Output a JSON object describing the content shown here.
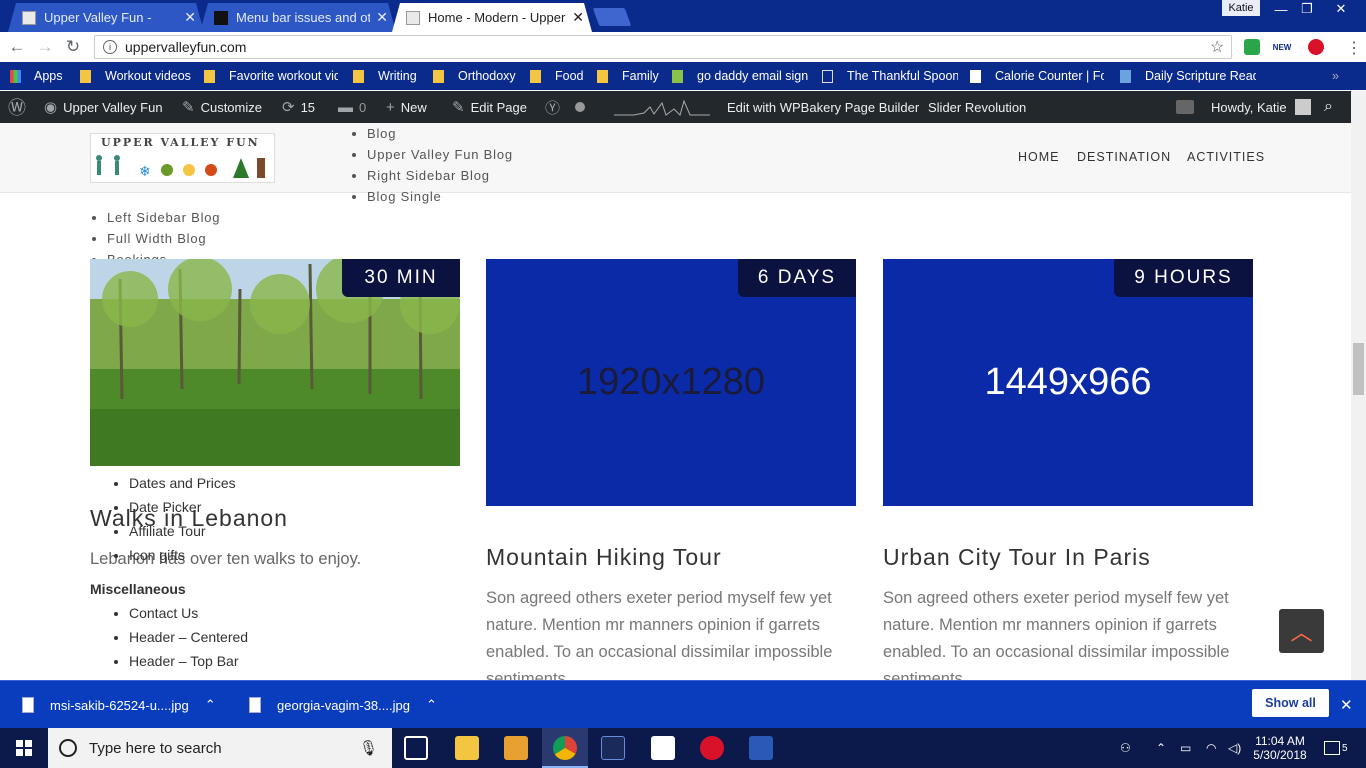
{
  "browser": {
    "tabs": [
      {
        "title": "Upper Valley Fun -",
        "active": false
      },
      {
        "title": "Menu bar issues and othe",
        "active": false
      },
      {
        "title": "Home - Modern - Upper",
        "active": true
      }
    ],
    "profile": "Katie",
    "url": "uppervalleyfun.com",
    "bookmarks": [
      "Apps",
      "Workout videos",
      "Favorite workout vid",
      "Writing",
      "Orthodoxy",
      "Food",
      "Family",
      "go daddy email sign",
      "The Thankful Spoon",
      "Calorie Counter | Fo",
      "Daily Scripture Read"
    ],
    "ext_new": "NEW"
  },
  "adminbar": {
    "site": "Upper Valley Fun",
    "customize": "Customize",
    "updates": "15",
    "comments": "0",
    "new": "New",
    "edit_page": "Edit Page",
    "wpbakery": "Edit with WPBakery Page Builder",
    "slider": "Slider Revolution",
    "howdy": "Howdy, Katie"
  },
  "site": {
    "logo_text": "UPPER VALLEY FUN",
    "nav": [
      "HOME",
      "DESTINATION",
      "ACTIVITIES"
    ],
    "dropdown_a": [
      "Blog",
      "Upper Valley Fun Blog",
      "Right Sidebar Blog",
      "Blog Single"
    ],
    "dropdown_b": [
      "Left Sidebar Blog",
      "Full Width Blog",
      "Bookings"
    ],
    "dropdown_c": [
      "Dates and Prices",
      "Date Picker",
      "Affiliate Tour",
      "Icon gifts"
    ],
    "misc_heading": "Miscellaneous",
    "dropdown_d": [
      "Contact Us",
      "Header – Centered",
      "Header – Top Bar"
    ]
  },
  "cards": [
    {
      "badge": "30 MIN",
      "title": "Walks in Lebanon",
      "desc": "Lebanon has over ten walks to enjoy.",
      "placeholder": ""
    },
    {
      "badge": "6 DAYS",
      "title": "Mountain Hiking Tour",
      "desc": "Son agreed others exeter period myself few yet nature. Mention mr manners opinion if garrets enabled. To an occasional dissimilar impossible sentiments.",
      "placeholder": "1920x1280"
    },
    {
      "badge": "9 HOURS",
      "title": "Urban City Tour In Paris",
      "desc": "Son agreed others exeter period myself few yet nature. Mention mr manners opinion if garrets enabled. To an occasional dissimilar impossible sentiments.",
      "placeholder": "1449x966"
    }
  ],
  "downloads": {
    "items": [
      "msi-sakib-62524-u....jpg",
      "georgia-vagim-38....jpg"
    ],
    "show_all": "Show all"
  },
  "taskbar": {
    "search_placeholder": "Type here to search",
    "time": "11:04 AM",
    "date": "5/30/2018",
    "notifications": "5"
  },
  "colors": {
    "chrome_blue": "#0a2a8c",
    "placeholder_blue": "#0b2aa8",
    "admin_bar": "#23282d",
    "accent": "#ff6a4a"
  }
}
